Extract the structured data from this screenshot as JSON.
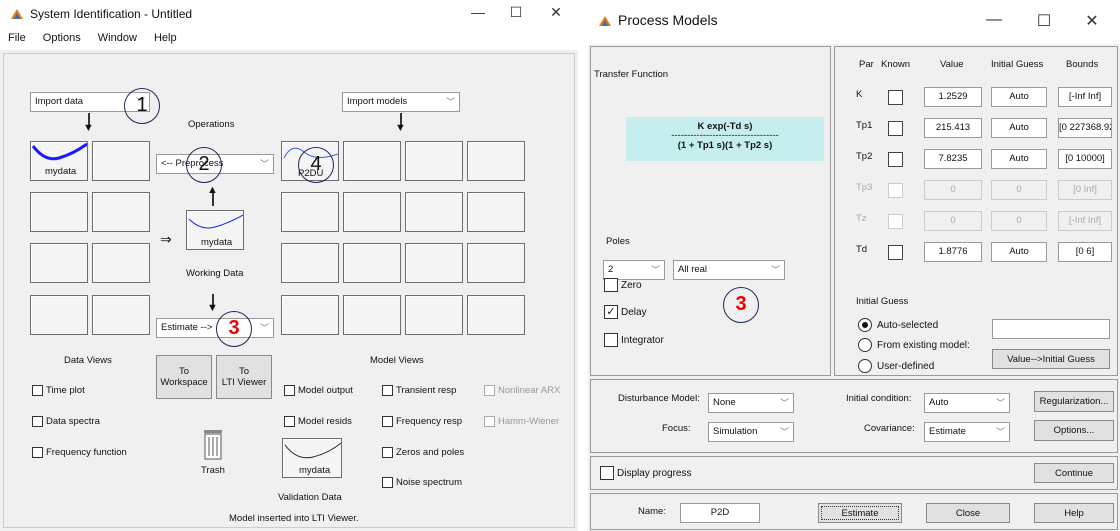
{
  "left": {
    "title": "System Identification - Untitled",
    "menu": [
      "File",
      "Options",
      "Window",
      "Help"
    ],
    "import_data": "Import data",
    "import_models": "Import models",
    "operations": "Operations",
    "preprocess": "<-- Preprocess",
    "data_slot": "mydata",
    "working_data": "mydata",
    "working_data_label": "Working Data",
    "estimate": "Estimate -->",
    "model_slot": "P2DU",
    "data_views_label": "Data Views",
    "model_views_label": "Model Views",
    "to_workspace": [
      "To",
      "Workspace"
    ],
    "to_lti": [
      "To",
      "LTI Viewer"
    ],
    "data_views": [
      "Time plot",
      "Data spectra",
      "Frequency function"
    ],
    "model_views_a": [
      "Model output",
      "Model resids"
    ],
    "model_views_b": [
      "Transient resp",
      "Frequency resp",
      "Zeros and poles",
      "Noise spectrum"
    ],
    "model_views_c": [
      "Nonlinear ARX",
      "Hamm-Wiener"
    ],
    "trash": "Trash",
    "validation_data": "mydata",
    "validation_label": "Validation Data",
    "status": "Model inserted into LTI Viewer.",
    "markers": [
      "1",
      "2",
      "3",
      "4"
    ]
  },
  "right": {
    "title": "Process Models",
    "transfer_function_label": "Transfer Function",
    "tf_numerator": "K exp(-Td s)",
    "tf_divider": "----------------------------------",
    "tf_denominator": "(1 + Tp1 s)(1 + Tp2 s)",
    "poles_label": "Poles",
    "poles_count": "2",
    "poles_type": "All real",
    "zero": "Zero",
    "delay": "Delay",
    "integrator": "Integrator",
    "marker": "3",
    "headers": [
      "Par",
      "Known",
      "Value",
      "Initial Guess",
      "Bounds"
    ],
    "params": [
      {
        "par": "K",
        "value": "1.2529",
        "guess": "Auto",
        "bounds": "[-Inf Inf]",
        "enabled": true
      },
      {
        "par": "Tp1",
        "value": "215.413",
        "guess": "Auto",
        "bounds": "[0 227368.92",
        "enabled": true
      },
      {
        "par": "Tp2",
        "value": "7.8235",
        "guess": "Auto",
        "bounds": "[0 10000]",
        "enabled": true
      },
      {
        "par": "Tp3",
        "value": "0",
        "guess": "0",
        "bounds": "[0 Inf]",
        "enabled": false
      },
      {
        "par": "Tz",
        "value": "0",
        "guess": "0",
        "bounds": "[-Inf Inf]",
        "enabled": false
      },
      {
        "par": "Td",
        "value": "1.8776",
        "guess": "Auto",
        "bounds": "[0 6]",
        "enabled": true
      }
    ],
    "initial_guess_label": "Initial Guess",
    "auto_selected": "Auto-selected",
    "from_existing": "From existing model:",
    "user_defined": "User-defined",
    "value_to_guess": "Value-->Initial Guess",
    "disturbance_label": "Disturbance Model:",
    "disturbance_value": "None",
    "focus_label": "Focus:",
    "focus_value": "Simulation",
    "initial_condition_label": "Initial condition:",
    "initial_condition_value": "Auto",
    "covariance_label": "Covariance:",
    "covariance_value": "Estimate",
    "regularization": "Regularization...",
    "options": "Options...",
    "display_progress": "Display progress",
    "continue": "Continue",
    "name_label": "Name:",
    "name_value": "P2D",
    "estimate": "Estimate",
    "close": "Close",
    "help": "Help"
  }
}
